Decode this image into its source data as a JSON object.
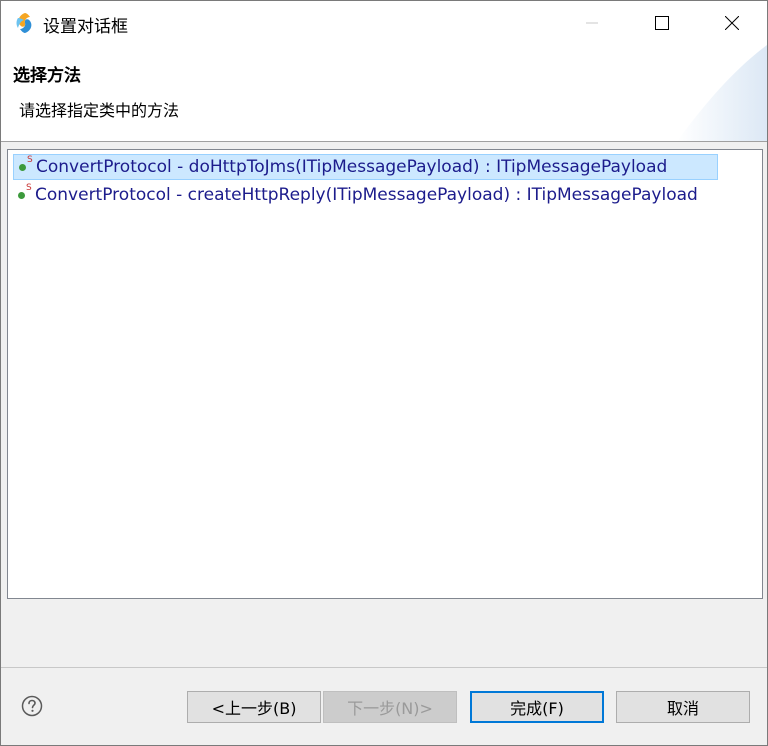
{
  "window": {
    "title": "设置对话框"
  },
  "header": {
    "title": "选择方法",
    "description": "请选择指定类中的方法"
  },
  "methods": [
    {
      "label": "ConvertProtocol - doHttpToJms(ITipMessagePayload) : ITipMessagePayload",
      "selected": true
    },
    {
      "label": "ConvertProtocol - createHttpReply(ITipMessagePayload) : ITipMessagePayload",
      "selected": false
    }
  ],
  "method_icon_badge": "S",
  "buttons": {
    "back": "<上一步(B)",
    "next": "下一步(N)>",
    "finish": "完成(F)",
    "cancel": "取消"
  },
  "colors": {
    "selection_bg": "#cce8ff",
    "method_text": "#1c1c8c",
    "default_button_border": "#0078d7"
  }
}
